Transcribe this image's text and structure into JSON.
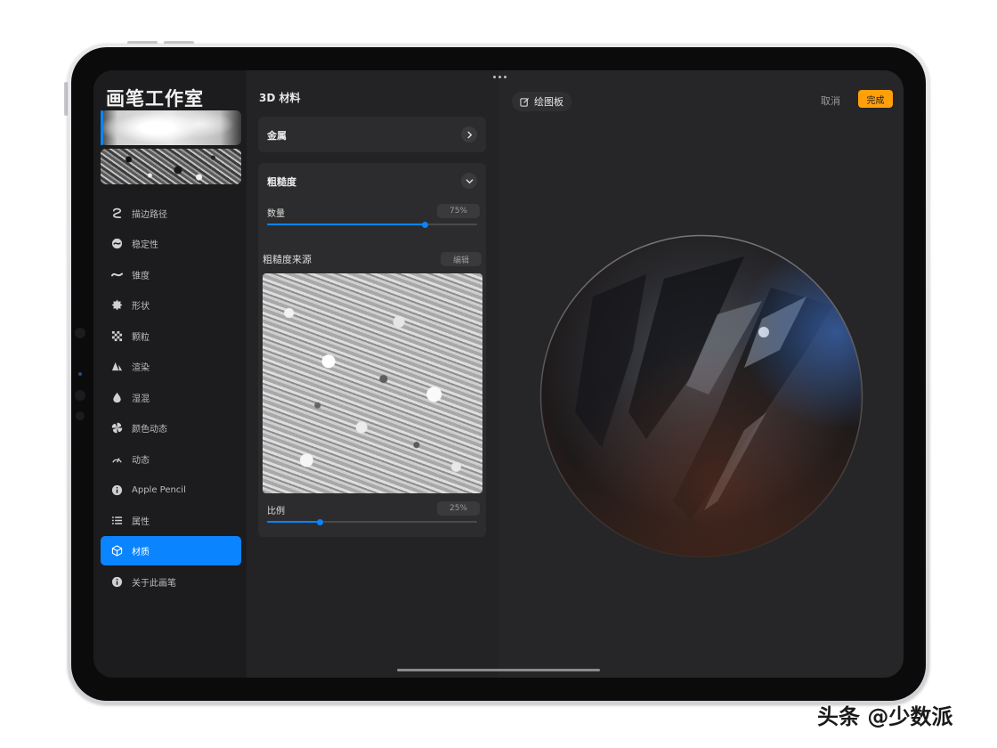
{
  "sidebar": {
    "title": "画笔工作室",
    "items": [
      {
        "label": "描边路径",
        "icon": "stroke-path-icon"
      },
      {
        "label": "稳定性",
        "icon": "stabilization-icon"
      },
      {
        "label": "锥度",
        "icon": "taper-icon"
      },
      {
        "label": "形状",
        "icon": "shape-icon"
      },
      {
        "label": "颗粒",
        "icon": "grain-icon"
      },
      {
        "label": "渲染",
        "icon": "rendering-icon"
      },
      {
        "label": "湿混",
        "icon": "wet-mix-icon"
      },
      {
        "label": "颜色动态",
        "icon": "color-dynamics-icon"
      },
      {
        "label": "动态",
        "icon": "dynamics-icon"
      },
      {
        "label": "Apple Pencil",
        "icon": "info-icon"
      },
      {
        "label": "属性",
        "icon": "properties-icon"
      },
      {
        "label": "材质",
        "icon": "cube-icon",
        "active": true
      },
      {
        "label": "关于此画笔",
        "icon": "info-icon"
      }
    ]
  },
  "panel": {
    "title": "3D 材料",
    "metal": {
      "label": "金属"
    },
    "roughness": {
      "label": "粗糙度",
      "amount_label": "数量",
      "amount_value": "75%",
      "amount_fraction": 0.75,
      "source_label": "粗糙度来源",
      "edit_label": "编辑",
      "scale_label": "比例",
      "scale_value": "25%",
      "scale_fraction": 0.25
    }
  },
  "canvas": {
    "canvas_button": "绘图板",
    "cancel": "取消",
    "done": "完成"
  },
  "watermark": "头条 @少数派",
  "colors": {
    "accent": "#0a84ff",
    "done_button": "#ff9f0a",
    "background": "#1c1c1e"
  }
}
